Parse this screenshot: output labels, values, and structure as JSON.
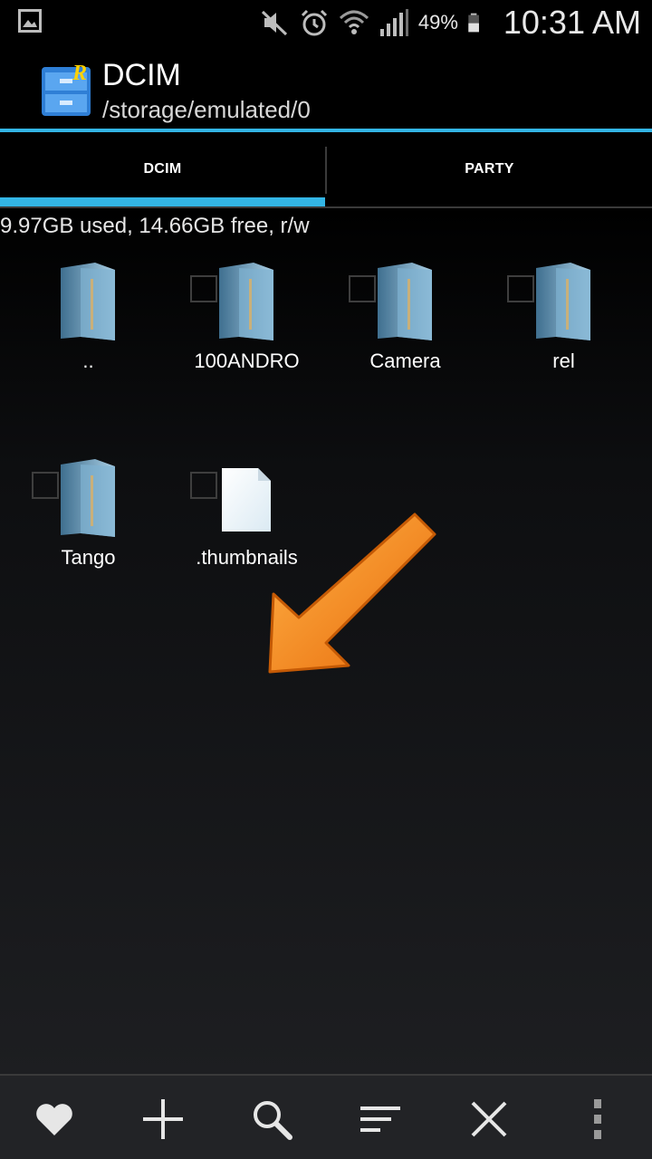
{
  "status_bar": {
    "battery_percent": "49%",
    "time": "10:31 AM",
    "icons": [
      "gallery-icon",
      "mute-icon",
      "alarm-icon",
      "wifi-icon",
      "signal-icon",
      "battery-icon"
    ]
  },
  "header": {
    "title": "DCIM",
    "path": "/storage/emulated/0"
  },
  "tabs": [
    {
      "label": "DCIM",
      "active": true
    },
    {
      "label": "PARTY",
      "active": false
    }
  ],
  "storage_info": "9.97GB used, 14.66GB free, r/w",
  "items": [
    {
      "label": "..",
      "type": "folder",
      "checkbox": false
    },
    {
      "label": "100ANDRO",
      "type": "folder",
      "checkbox": true
    },
    {
      "label": "Camera",
      "type": "folder",
      "checkbox": true
    },
    {
      "label": "rel",
      "type": "folder",
      "checkbox": true
    },
    {
      "label": "Tango",
      "type": "folder",
      "checkbox": true
    },
    {
      "label": ".thumbnails",
      "type": "file",
      "checkbox": true
    }
  ],
  "bottom_bar": {
    "buttons": [
      "heart-icon",
      "plus-icon",
      "search-icon",
      "sort-icon",
      "close-icon",
      "overflow-menu-icon"
    ]
  },
  "colors": {
    "accent": "#33b5e5",
    "arrow": "#f07c12"
  }
}
